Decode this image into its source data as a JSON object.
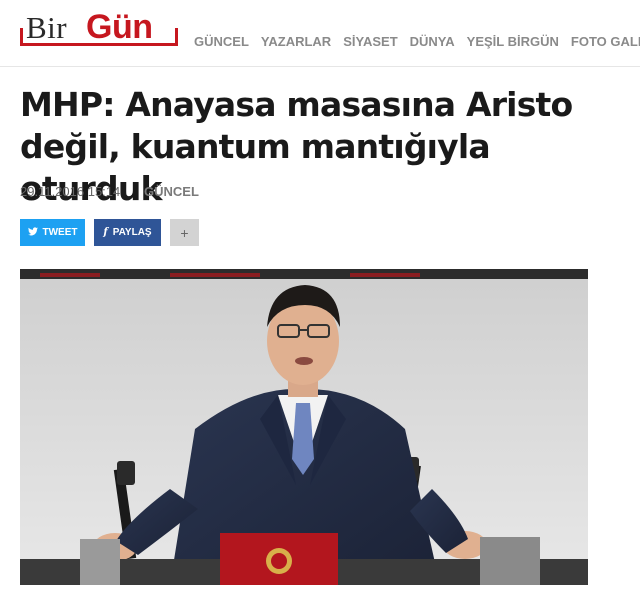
{
  "site": {
    "logo_part1": "BirG",
    "logo_part2": "ün"
  },
  "nav": [
    {
      "label": "GÜNCEL"
    },
    {
      "label": "YAZARLAR"
    },
    {
      "label": "SİYASET"
    },
    {
      "label": "DÜNYA"
    },
    {
      "label": "YEŞİL BİRGÜN"
    },
    {
      "label": "FOTO GALERİ"
    }
  ],
  "article": {
    "title": "MHP: Anayasa masasına Aristo değil, kuantum mantığıyla oturduk",
    "date": "29.11.2016 15:14",
    "category": "GÜNCEL"
  },
  "share": {
    "tweet_label": "TWEET",
    "paylas_label": "PAYLAŞ",
    "more_label": "+",
    "tweet_icon": "twitter-bird-icon",
    "paylas_icon": "facebook-f-icon",
    "tweet_color": "#1da1f2",
    "paylas_color": "#2f5597"
  },
  "photo": {
    "subject": "speaker-at-parliament-podium"
  },
  "colors": {
    "brand_red": "#c6171f",
    "nav_gray": "#8a8a8a"
  }
}
